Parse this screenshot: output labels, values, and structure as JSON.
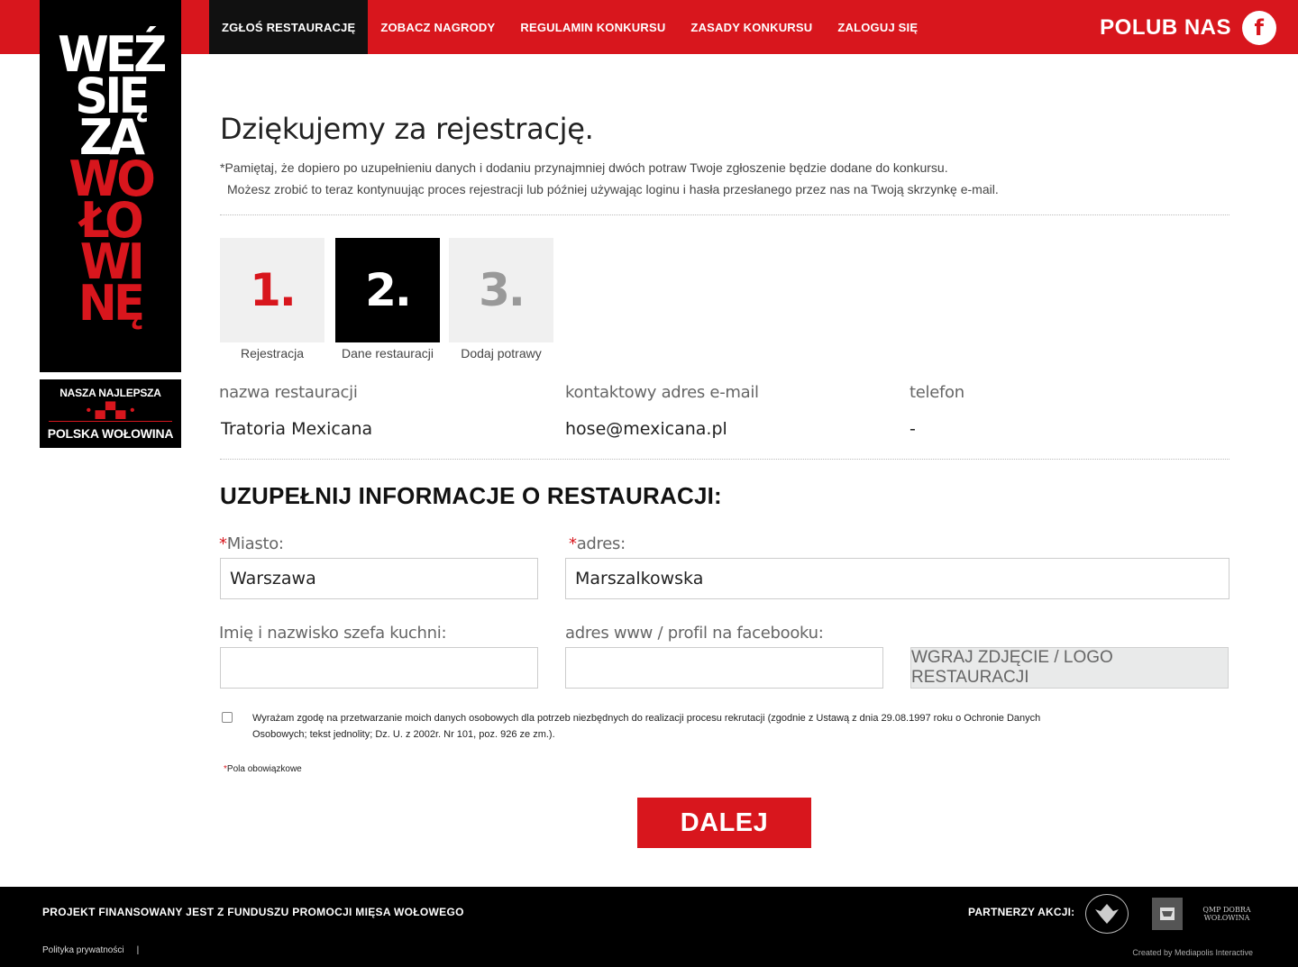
{
  "nav": {
    "items": [
      {
        "label": "ZGŁOŚ RESTAURACJĘ",
        "active": true
      },
      {
        "label": "ZOBACZ NAGRODY",
        "active": false
      },
      {
        "label": "REGULAMIN KONKURSU",
        "active": false
      },
      {
        "label": "ZASADY KONKURSU",
        "active": false
      },
      {
        "label": "ZALOGUJ SIĘ",
        "active": false
      }
    ],
    "like_label": "POLUB NAS",
    "facebook_icon": "f"
  },
  "logo": {
    "lines": [
      {
        "text": "WEŹ",
        "color": "white"
      },
      {
        "text": "SIĘ",
        "color": "white"
      },
      {
        "text": "ZA",
        "color": "white"
      },
      {
        "text": "WO",
        "color": "red"
      },
      {
        "text": "ŁO",
        "color": "red"
      },
      {
        "text": "WI",
        "color": "red"
      },
      {
        "text": "NĘ",
        "color": "red"
      }
    ],
    "badge_top": "NASZA NAJLEPSZA",
    "badge_bottom": "POLSKA WOŁOWINA"
  },
  "page": {
    "title": "Dziękujemy za rejestrację.",
    "note_line1": "*Pamiętaj, że dopiero po uzupełnieniu danych i dodaniu przynajmniej dwóch potraw Twoje zgłoszenie będzie dodane do konkursu.",
    "note_line2": "Możesz zrobić to teraz kontynuując proces rejestracji lub później używając loginu i hasła przesłanego przez nas na Twoją skrzynkę e-mail."
  },
  "steps": [
    {
      "number": "1.",
      "label": "Rejestracja"
    },
    {
      "number": "2.",
      "label": "Dane restauracji"
    },
    {
      "number": "3.",
      "label": "Dodaj potrawy"
    }
  ],
  "summary": {
    "name_label": "nazwa restauracji",
    "name_value": "Tratoria Mexicana",
    "email_label": "kontaktowy adres e-mail",
    "email_value": "hose@mexicana.pl",
    "phone_label": "telefon",
    "phone_value": "-"
  },
  "form": {
    "section_title": "UZUPEŁNIJ INFORMACJE O RESTAURACJI:",
    "required_mark": "*",
    "city_label": "Miasto:",
    "city_value": "Warszawa",
    "address_label": "adres:",
    "address_value": "Marszalkowska",
    "chef_label": "Imię i nazwisko szefa kuchni:",
    "chef_value": "",
    "www_label": "adres www / profil na facebooku:",
    "www_value": "",
    "upload_label": "WGRAJ ZDJĘCIE / LOGO RESTAURACJI",
    "consent_text": "Wyrażam zgodę na przetwarzanie moich danych osobowych dla potrzeb niezbędnych do realizacji procesu rekrutacji (zgodnie z Ustawą z dnia 29.08.1997 roku o Ochronie Danych Osobowych; tekst jednolity; Dz. U. z 2002r. Nr 101, poz. 926 ze zm.).",
    "consent_checked": false,
    "required_note": "Pola obowiązkowe",
    "next_label": "DALEJ"
  },
  "footer": {
    "project": "PROJEKT FINANSOWANY JEST Z FUNDUSZU PROMOCJI MIĘSA WOŁOWEGO",
    "partners": "PARTNERZY AKCJI:",
    "privacy": "Polityka prywatności",
    "separator": "|",
    "credit": "Created by Mediapolis Interactive",
    "partner3": "QMP DOBRA WOŁOWINA"
  },
  "colors": {
    "brand_red": "#d8161d",
    "black": "#000000"
  }
}
